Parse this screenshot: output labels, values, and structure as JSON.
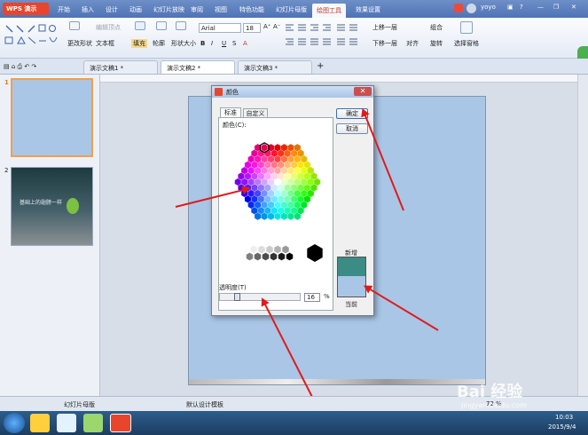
{
  "app": {
    "logo": "WPS 演示"
  },
  "menu_tabs": [
    "开始",
    "插入",
    "设计",
    "动画",
    "幻灯片放映",
    "审阅",
    "视图",
    "特色功能",
    "幻灯片母版",
    "绘图工具",
    "效果设置"
  ],
  "user": {
    "name": "yoyo"
  },
  "ribbon": {
    "col1": [
      "更改形状",
      "文本框"
    ],
    "fill": "填充",
    "outline": "轮廓",
    "shape_size": "形状大小",
    "font_name": "Arial",
    "font_size": "18",
    "format_letters": [
      "B",
      "I",
      "U",
      "S",
      "A"
    ],
    "arrange": [
      "上移一层",
      "下移一层",
      "组合",
      "对齐",
      "旋转"
    ],
    "select_pane": "选择窗格",
    "disabled_label": "编辑顶点"
  },
  "doc_tabs": [
    "演示文稿1 *",
    "演示文稿2 *",
    "演示文稿3 *"
  ],
  "thumbs": [
    {
      "num": "1"
    },
    {
      "num": "2",
      "caption": "基础上的翅膀一样"
    }
  ],
  "dialog": {
    "title": "颜色",
    "tabs": [
      "标准",
      "自定义"
    ],
    "colors_label": "颜色(C):",
    "ok": "确定",
    "cancel": "取消",
    "new_label": "新增",
    "current_label": "当前",
    "transparency_label": "透明度(T)",
    "transparency_value": "16",
    "transparency_unit": "%"
  },
  "status": {
    "left": "幻灯片母版",
    "center": "默认设计模板",
    "zoom": "72 %"
  },
  "taskbar": {
    "time": "10:03",
    "date": "2015/9/4"
  },
  "watermark": {
    "text": "Bai 经验",
    "url": "jingyan.baidu.com"
  },
  "colors": {
    "new": "#3a8c84",
    "current": "#a9c6e6",
    "accent": "#e01b1b"
  }
}
